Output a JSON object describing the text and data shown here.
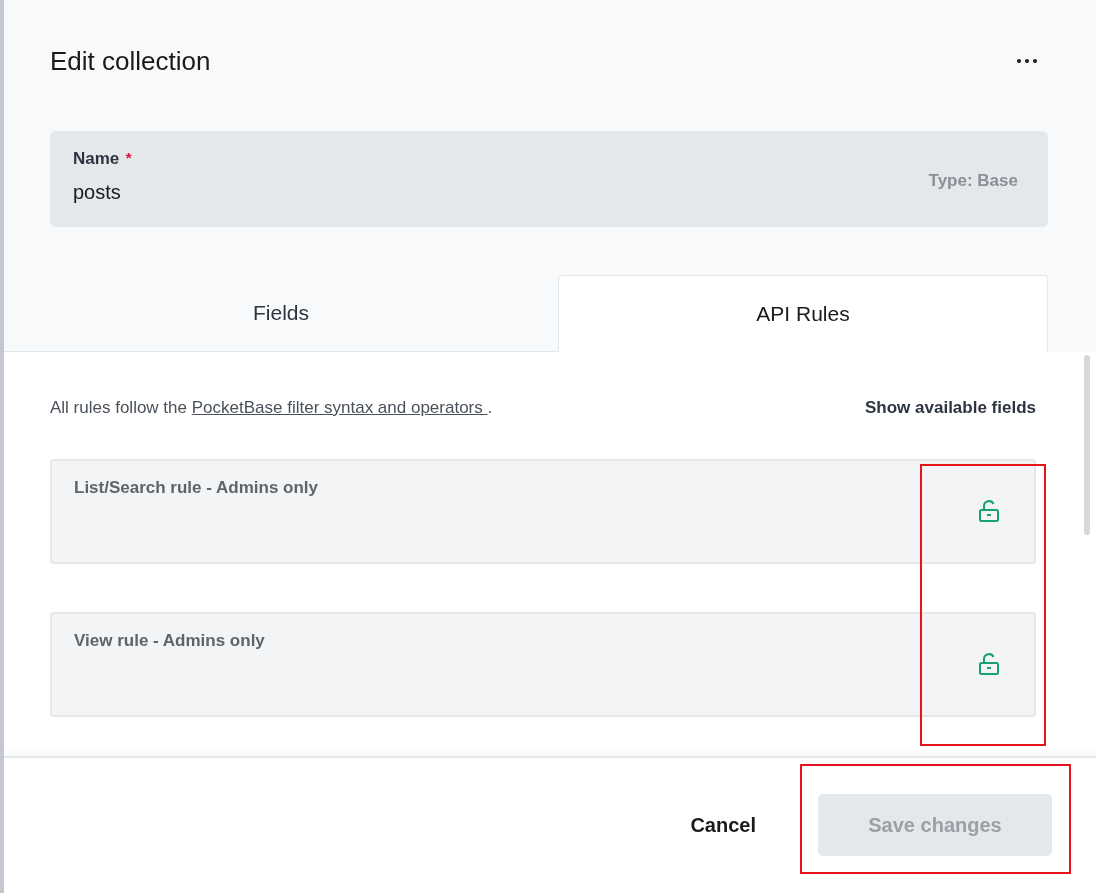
{
  "window": {
    "title": "Edit collection"
  },
  "name_field": {
    "label": "Name",
    "required_mark": "*",
    "value": "posts",
    "type_label": "Type: Base"
  },
  "tabs": [
    {
      "label": "Fields",
      "selected": false
    },
    {
      "label": "API Rules",
      "selected": true
    }
  ],
  "rules_intro": {
    "prefix": "All rules follow the ",
    "link": "PocketBase filter syntax and operators ",
    "suffix": "."
  },
  "show_fields": "Show available fields",
  "rules": [
    {
      "label": "List/Search rule - Admins only",
      "locked": false
    },
    {
      "label": "View rule - Admins only",
      "locked": false
    }
  ],
  "footer": {
    "cancel": "Cancel",
    "save": {
      "label": "Save changes",
      "disabled": true
    }
  }
}
